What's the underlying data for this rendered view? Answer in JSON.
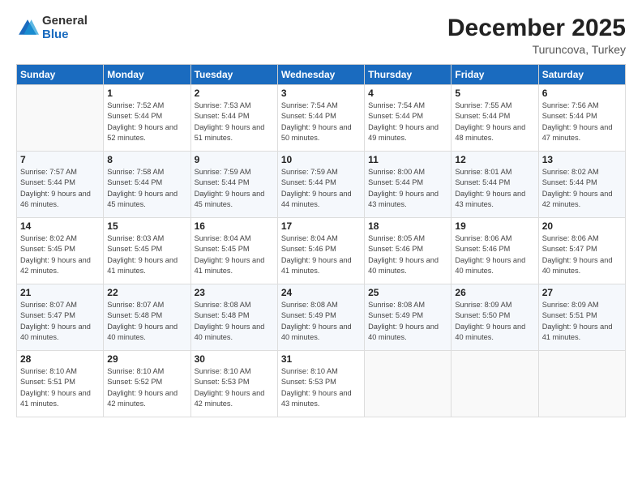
{
  "header": {
    "logo_general": "General",
    "logo_blue": "Blue",
    "month_title": "December 2025",
    "location": "Turuncova, Turkey"
  },
  "days_of_week": [
    "Sunday",
    "Monday",
    "Tuesday",
    "Wednesday",
    "Thursday",
    "Friday",
    "Saturday"
  ],
  "weeks": [
    [
      null,
      {
        "day": 1,
        "sunrise": "7:52 AM",
        "sunset": "5:44 PM",
        "daylight": "9 hours and 52 minutes."
      },
      {
        "day": 2,
        "sunrise": "7:53 AM",
        "sunset": "5:44 PM",
        "daylight": "9 hours and 51 minutes."
      },
      {
        "day": 3,
        "sunrise": "7:54 AM",
        "sunset": "5:44 PM",
        "daylight": "9 hours and 50 minutes."
      },
      {
        "day": 4,
        "sunrise": "7:54 AM",
        "sunset": "5:44 PM",
        "daylight": "9 hours and 49 minutes."
      },
      {
        "day": 5,
        "sunrise": "7:55 AM",
        "sunset": "5:44 PM",
        "daylight": "9 hours and 48 minutes."
      },
      {
        "day": 6,
        "sunrise": "7:56 AM",
        "sunset": "5:44 PM",
        "daylight": "9 hours and 47 minutes."
      }
    ],
    [
      {
        "day": 7,
        "sunrise": "7:57 AM",
        "sunset": "5:44 PM",
        "daylight": "9 hours and 46 minutes."
      },
      {
        "day": 8,
        "sunrise": "7:58 AM",
        "sunset": "5:44 PM",
        "daylight": "9 hours and 45 minutes."
      },
      {
        "day": 9,
        "sunrise": "7:59 AM",
        "sunset": "5:44 PM",
        "daylight": "9 hours and 45 minutes."
      },
      {
        "day": 10,
        "sunrise": "7:59 AM",
        "sunset": "5:44 PM",
        "daylight": "9 hours and 44 minutes."
      },
      {
        "day": 11,
        "sunrise": "8:00 AM",
        "sunset": "5:44 PM",
        "daylight": "9 hours and 43 minutes."
      },
      {
        "day": 12,
        "sunrise": "8:01 AM",
        "sunset": "5:44 PM",
        "daylight": "9 hours and 43 minutes."
      },
      {
        "day": 13,
        "sunrise": "8:02 AM",
        "sunset": "5:44 PM",
        "daylight": "9 hours and 42 minutes."
      }
    ],
    [
      {
        "day": 14,
        "sunrise": "8:02 AM",
        "sunset": "5:45 PM",
        "daylight": "9 hours and 42 minutes."
      },
      {
        "day": 15,
        "sunrise": "8:03 AM",
        "sunset": "5:45 PM",
        "daylight": "9 hours and 41 minutes."
      },
      {
        "day": 16,
        "sunrise": "8:04 AM",
        "sunset": "5:45 PM",
        "daylight": "9 hours and 41 minutes."
      },
      {
        "day": 17,
        "sunrise": "8:04 AM",
        "sunset": "5:46 PM",
        "daylight": "9 hours and 41 minutes."
      },
      {
        "day": 18,
        "sunrise": "8:05 AM",
        "sunset": "5:46 PM",
        "daylight": "9 hours and 40 minutes."
      },
      {
        "day": 19,
        "sunrise": "8:06 AM",
        "sunset": "5:46 PM",
        "daylight": "9 hours and 40 minutes."
      },
      {
        "day": 20,
        "sunrise": "8:06 AM",
        "sunset": "5:47 PM",
        "daylight": "9 hours and 40 minutes."
      }
    ],
    [
      {
        "day": 21,
        "sunrise": "8:07 AM",
        "sunset": "5:47 PM",
        "daylight": "9 hours and 40 minutes."
      },
      {
        "day": 22,
        "sunrise": "8:07 AM",
        "sunset": "5:48 PM",
        "daylight": "9 hours and 40 minutes."
      },
      {
        "day": 23,
        "sunrise": "8:08 AM",
        "sunset": "5:48 PM",
        "daylight": "9 hours and 40 minutes."
      },
      {
        "day": 24,
        "sunrise": "8:08 AM",
        "sunset": "5:49 PM",
        "daylight": "9 hours and 40 minutes."
      },
      {
        "day": 25,
        "sunrise": "8:08 AM",
        "sunset": "5:49 PM",
        "daylight": "9 hours and 40 minutes."
      },
      {
        "day": 26,
        "sunrise": "8:09 AM",
        "sunset": "5:50 PM",
        "daylight": "9 hours and 40 minutes."
      },
      {
        "day": 27,
        "sunrise": "8:09 AM",
        "sunset": "5:51 PM",
        "daylight": "9 hours and 41 minutes."
      }
    ],
    [
      {
        "day": 28,
        "sunrise": "8:10 AM",
        "sunset": "5:51 PM",
        "daylight": "9 hours and 41 minutes."
      },
      {
        "day": 29,
        "sunrise": "8:10 AM",
        "sunset": "5:52 PM",
        "daylight": "9 hours and 42 minutes."
      },
      {
        "day": 30,
        "sunrise": "8:10 AM",
        "sunset": "5:53 PM",
        "daylight": "9 hours and 42 minutes."
      },
      {
        "day": 31,
        "sunrise": "8:10 AM",
        "sunset": "5:53 PM",
        "daylight": "9 hours and 43 minutes."
      },
      null,
      null,
      null
    ]
  ]
}
